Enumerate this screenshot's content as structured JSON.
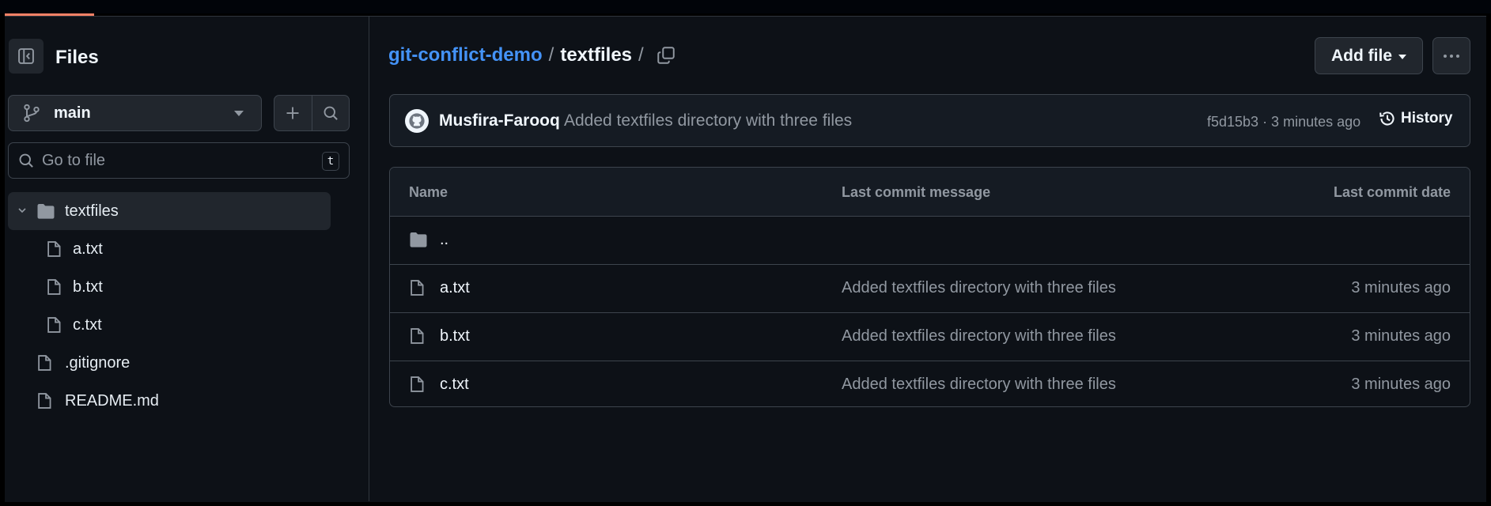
{
  "sidebar": {
    "title": "Files",
    "branch": "main",
    "search_placeholder": "Go to file",
    "search_shortcut": "t",
    "tree": [
      {
        "label": "textfiles",
        "type": "folder",
        "expanded": true
      },
      {
        "label": "a.txt",
        "type": "file",
        "level": 1
      },
      {
        "label": "b.txt",
        "type": "file",
        "level": 1
      },
      {
        "label": "c.txt",
        "type": "file",
        "level": 1
      },
      {
        "label": ".gitignore",
        "type": "file",
        "level": 0
      },
      {
        "label": "README.md",
        "type": "file",
        "level": 0
      }
    ]
  },
  "breadcrumb": {
    "repo": "git-conflict-demo",
    "separator": "/",
    "dir": "textfiles",
    "trailing": "/"
  },
  "actions": {
    "add_file": "Add file"
  },
  "commit": {
    "author": "Musfira-Farooq",
    "message": "Added textfiles directory with three files",
    "meta": "f5d15b3 · 3 minutes ago",
    "history": "History"
  },
  "table": {
    "headers": [
      "Name",
      "Last commit message",
      "Last commit date"
    ],
    "parent": "..",
    "rows": [
      {
        "name": "a.txt",
        "message": "Added textfiles directory with three files",
        "date": "3 minutes ago"
      },
      {
        "name": "b.txt",
        "message": "Added textfiles directory with three files",
        "date": "3 minutes ago"
      },
      {
        "name": "c.txt",
        "message": "Added textfiles directory with three files",
        "date": "3 minutes ago"
      }
    ]
  },
  "colors": {
    "background": "#0d1117",
    "link": "#4493f8",
    "border": "#3d444d",
    "progress": "#f78166"
  }
}
